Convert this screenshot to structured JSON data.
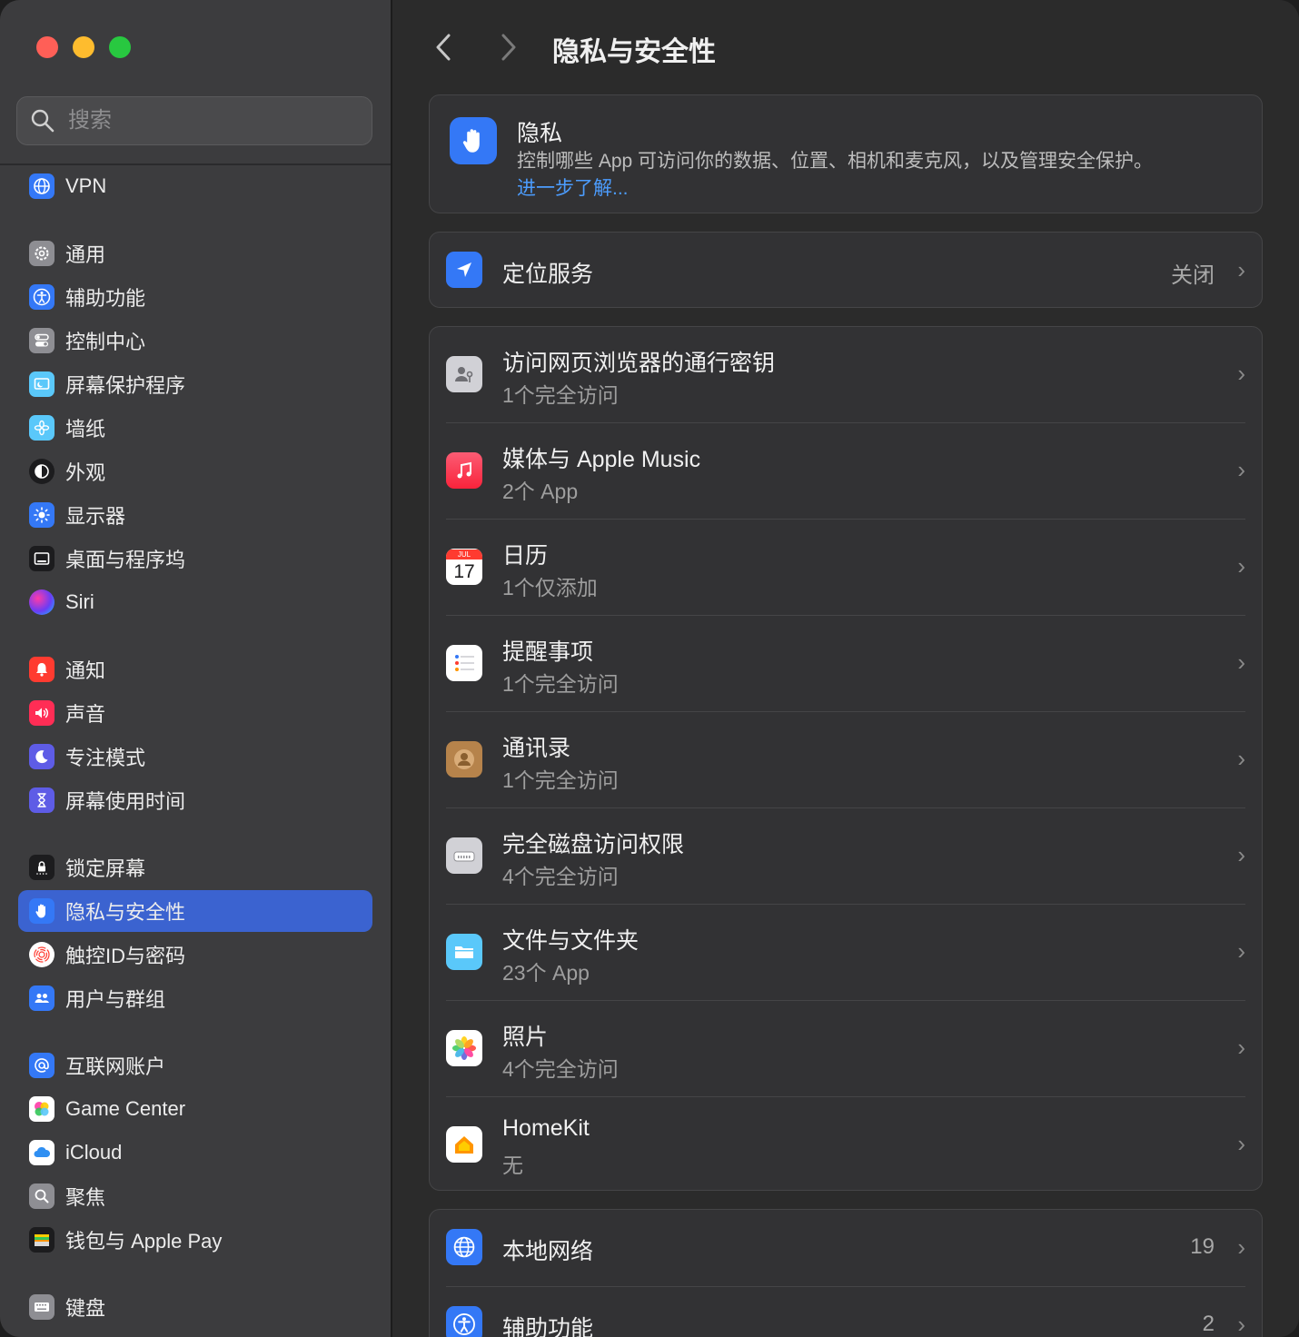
{
  "window": {
    "title": "隐私与安全性"
  },
  "sidebar": {
    "search_placeholder": "搜索",
    "items": [
      {
        "label": "VPN",
        "icon": "globe-icon",
        "color": "#3478f6"
      },
      {
        "label": "通用",
        "icon": "gear-icon",
        "color": "#8e8e93"
      },
      {
        "label": "辅助功能",
        "icon": "accessibility-icon",
        "color": "#3478f6"
      },
      {
        "label": "控制中心",
        "icon": "toggles-icon",
        "color": "#8e8e93"
      },
      {
        "label": "屏幕保护程序",
        "icon": "screensaver-icon",
        "color": "#5ac8fa"
      },
      {
        "label": "墙纸",
        "icon": "flower-icon",
        "color": "#5ac8fa"
      },
      {
        "label": "外观",
        "icon": "appearance-icon",
        "color": "#1c1c1e"
      },
      {
        "label": "显示器",
        "icon": "sun-icon",
        "color": "#3478f6"
      },
      {
        "label": "桌面与程序坞",
        "icon": "dock-icon",
        "color": "#1c1c1e"
      },
      {
        "label": "Siri",
        "icon": "siri-icon",
        "color": "#5e35b1"
      },
      {
        "label": "通知",
        "icon": "bell-icon",
        "color": "#ff3b30"
      },
      {
        "label": "声音",
        "icon": "speaker-icon",
        "color": "#ff2d55"
      },
      {
        "label": "专注模式",
        "icon": "moon-icon",
        "color": "#5e5ce6"
      },
      {
        "label": "屏幕使用时间",
        "icon": "hourglass-icon",
        "color": "#5e5ce6"
      },
      {
        "label": "锁定屏幕",
        "icon": "lock-icon",
        "color": "#1c1c1e"
      },
      {
        "label": "隐私与安全性",
        "icon": "hand-icon",
        "color": "#3478f6"
      },
      {
        "label": "触控ID与密码",
        "icon": "fingerprint-icon",
        "color": "#ff3b30"
      },
      {
        "label": "用户与群组",
        "icon": "users-icon",
        "color": "#3478f6"
      },
      {
        "label": "互联网账户",
        "icon": "at-icon",
        "color": "#3478f6"
      },
      {
        "label": "Game Center",
        "icon": "game-center-icon",
        "color": "#ffffff"
      },
      {
        "label": "iCloud",
        "icon": "cloud-icon",
        "color": "#ffffff"
      },
      {
        "label": "聚焦",
        "icon": "magnifier-icon",
        "color": "#8e8e93"
      },
      {
        "label": "钱包与 Apple Pay",
        "icon": "wallet-icon",
        "color": "#1c1c1e"
      },
      {
        "label": "键盘",
        "icon": "keyboard-icon",
        "color": "#8e8e93"
      }
    ],
    "active_label": "隐私与安全性"
  },
  "main": {
    "title": "隐私与安全性",
    "privacy": {
      "title": "隐私",
      "description": "控制哪些 App 可访问你的数据、位置、相机和麦克风，以及管理安全保护。",
      "link": "进一步了解..."
    },
    "location": {
      "title": "定位服务",
      "value": "关闭"
    },
    "permissions": [
      {
        "title": "访问网页浏览器的通行密钥",
        "sub": "1个完全访问",
        "icon": "passkey-icon"
      },
      {
        "title": "媒体与 Apple Music",
        "sub": "2个 App",
        "icon": "music-icon"
      },
      {
        "title": "日历",
        "sub": "1个仅添加",
        "icon": "calendar-icon",
        "icon_month": "JUL",
        "icon_day": "17"
      },
      {
        "title": "提醒事项",
        "sub": "1个完全访问",
        "icon": "reminders-icon"
      },
      {
        "title": "通讯录",
        "sub": "1个完全访问",
        "icon": "contacts-icon"
      },
      {
        "title": "完全磁盘访问权限",
        "sub": "4个完全访问",
        "icon": "disk-icon"
      },
      {
        "title": "文件与文件夹",
        "sub": "23个 App",
        "icon": "folder-icon"
      },
      {
        "title": "照片",
        "sub": "4个完全访问",
        "icon": "photos-icon"
      },
      {
        "title": "HomeKit",
        "sub": "无",
        "icon": "home-icon"
      }
    ],
    "bottom": [
      {
        "title": "本地网络",
        "value": "19",
        "icon": "network-globe-icon"
      },
      {
        "title": "辅助功能",
        "value": "2",
        "icon": "accessibility-icon"
      }
    ]
  }
}
